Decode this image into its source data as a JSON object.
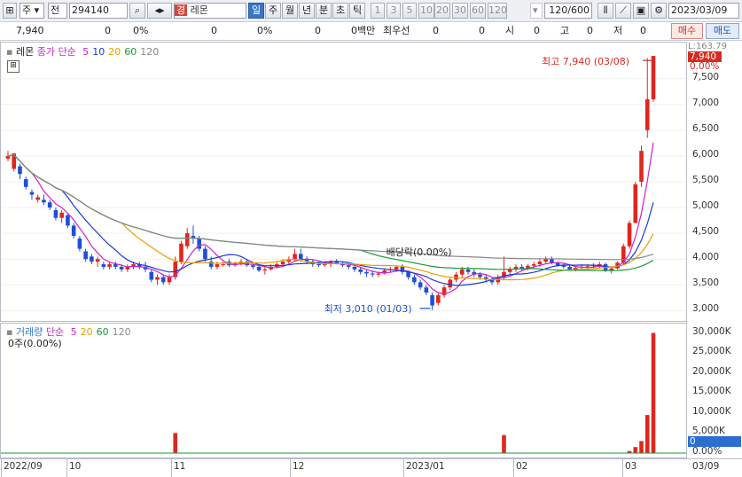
{
  "toolbar": {
    "market_label": "주",
    "prefix_label": "전",
    "code_value": "294140",
    "name_badge": "경",
    "name_value": "레몬",
    "periods": [
      "일",
      "주",
      "월",
      "년",
      "분",
      "초",
      "틱"
    ],
    "active_period": "일",
    "intervals": [
      "1",
      "3",
      "5",
      "10",
      "20",
      "30",
      "60",
      "120"
    ],
    "count_value": "120",
    "count_total": "/600",
    "date_value": "2023/03/09"
  },
  "quote": {
    "price": "7,940",
    "change": "0",
    "change_pct": "0%",
    "volume": "0",
    "vol_pct": "0%",
    "amount": "0",
    "amount_unit": "0백만",
    "best_label": "최우선",
    "best_value": "0",
    "open_value": "0",
    "open_label": "시",
    "open_v": "0",
    "high_label": "고",
    "high_v": "0",
    "low_label": "저",
    "low_v": "0",
    "buy_label": "매수",
    "sell_label": "매도"
  },
  "price_pane": {
    "stock_name": "레몬",
    "legend_title": "종가 단순",
    "ma": [
      "5",
      "10",
      "20",
      "60",
      "120"
    ],
    "ma_colors": [
      "#d020d0",
      "#1a3ad8",
      "#e8a000",
      "#1a9a3a",
      "#888888"
    ],
    "axis_ticks": [
      "7,500",
      "7,000",
      "6,500",
      "6,000",
      "5,500",
      "5,000",
      "4,500",
      "4,000",
      "3,500",
      "3,000"
    ],
    "top_label": "L:163.79",
    "price_tag": "7,940",
    "pct_tag": "0.00%",
    "high_note": "최고 7,940 (03/08)",
    "low_note": "최저 3,010 (01/03)",
    "div_note": "배당락(0.00%)"
  },
  "volume_pane": {
    "legend_title": "거래량",
    "legend_ma": "단순",
    "ma": [
      "5",
      "20",
      "60",
      "120"
    ],
    "readout": "0주(0.00%)",
    "axis_ticks": [
      "30,000K",
      "25,000K",
      "20,000K",
      "15,000K",
      "10,000K",
      "5,000K",
      "0.00%"
    ],
    "vol_tag": "0"
  },
  "date_axis": {
    "labels": [
      "2022/09",
      "10",
      "11",
      "12",
      "2023/01",
      "02",
      "03"
    ],
    "right_label": "03/09"
  },
  "chart_data": {
    "type": "candlestick",
    "y_range": [
      2800,
      8200
    ],
    "candles": [
      [
        5950,
        6100,
        5900,
        6000
      ],
      [
        5750,
        6050,
        5700,
        6050
      ],
      [
        5800,
        5850,
        5550,
        5650
      ],
      [
        5550,
        5600,
        5350,
        5400
      ],
      [
        5300,
        5350,
        5150,
        5250
      ],
      [
        5150,
        5250,
        5100,
        5200
      ],
      [
        5150,
        5250,
        5050,
        5100
      ],
      [
        5100,
        5150,
        4950,
        5000
      ],
      [
        4950,
        5000,
        4750,
        4800
      ],
      [
        4800,
        4950,
        4700,
        4900
      ],
      [
        4850,
        4900,
        4600,
        4650
      ],
      [
        4650,
        4700,
        4400,
        4450
      ],
      [
        4400,
        4450,
        4150,
        4200
      ],
      [
        4150,
        4200,
        3950,
        4000
      ],
      [
        4050,
        4100,
        3900,
        3950
      ],
      [
        3950,
        4050,
        3850,
        4000
      ],
      [
        3900,
        3950,
        3800,
        3850
      ],
      [
        3850,
        3950,
        3800,
        3900
      ],
      [
        3900,
        3950,
        3800,
        3850
      ],
      [
        3850,
        3900,
        3750,
        3800
      ],
      [
        3800,
        3900,
        3750,
        3850
      ],
      [
        3850,
        3950,
        3800,
        3900
      ],
      [
        3900,
        3950,
        3800,
        3850
      ],
      [
        3850,
        3950,
        3750,
        3800
      ],
      [
        3750,
        3800,
        3550,
        3600
      ],
      [
        3600,
        3700,
        3500,
        3650
      ],
      [
        3650,
        3700,
        3500,
        3550
      ],
      [
        3550,
        3700,
        3500,
        3650
      ],
      [
        3650,
        4050,
        3600,
        3950
      ],
      [
        3950,
        4350,
        3900,
        4300
      ],
      [
        4250,
        4600,
        4200,
        4500
      ],
      [
        4450,
        4650,
        4300,
        4400
      ],
      [
        4400,
        4450,
        4150,
        4200
      ],
      [
        4200,
        4250,
        3950,
        4000
      ],
      [
        3950,
        4050,
        3800,
        3850
      ],
      [
        3850,
        3950,
        3800,
        3900
      ],
      [
        3900,
        3950,
        3850,
        3900
      ],
      [
        3950,
        4000,
        3850,
        3880
      ],
      [
        3880,
        3950,
        3850,
        3920
      ],
      [
        3920,
        4000,
        3880,
        3950
      ],
      [
        3950,
        4000,
        3850,
        3880
      ],
      [
        3880,
        3920,
        3800,
        3850
      ],
      [
        3850,
        3900,
        3750,
        3780
      ],
      [
        3780,
        3850,
        3700,
        3800
      ],
      [
        3800,
        3900,
        3780,
        3850
      ],
      [
        3850,
        3950,
        3820,
        3900
      ],
      [
        3900,
        4000,
        3850,
        3950
      ],
      [
        3950,
        4050,
        3900,
        4000
      ],
      [
        4000,
        4200,
        3950,
        4100
      ],
      [
        4100,
        4200,
        3950,
        4000
      ],
      [
        4000,
        4050,
        3900,
        3950
      ],
      [
        3950,
        4000,
        3850,
        3900
      ],
      [
        3900,
        3950,
        3850,
        3880
      ],
      [
        3880,
        3950,
        3850,
        3900
      ],
      [
        3900,
        3980,
        3850,
        3950
      ],
      [
        3950,
        4000,
        3900,
        3920
      ],
      [
        3920,
        3960,
        3850,
        3880
      ],
      [
        3880,
        3920,
        3800,
        3850
      ],
      [
        3850,
        3900,
        3750,
        3800
      ],
      [
        3800,
        3850,
        3700,
        3750
      ],
      [
        3750,
        3800,
        3650,
        3720
      ],
      [
        3720,
        3780,
        3650,
        3700
      ],
      [
        3700,
        3760,
        3650,
        3720
      ],
      [
        3720,
        3800,
        3700,
        3780
      ],
      [
        3780,
        3850,
        3750,
        3800
      ],
      [
        3800,
        3880,
        3750,
        3850
      ],
      [
        3850,
        3900,
        3700,
        3750
      ],
      [
        3750,
        3780,
        3600,
        3650
      ],
      [
        3650,
        3700,
        3500,
        3550
      ],
      [
        3550,
        3600,
        3400,
        3450
      ],
      [
        3450,
        3500,
        3300,
        3350
      ],
      [
        3300,
        3350,
        3010,
        3100
      ],
      [
        3150,
        3350,
        3100,
        3300
      ],
      [
        3300,
        3500,
        3250,
        3450
      ],
      [
        3450,
        3650,
        3400,
        3600
      ],
      [
        3600,
        3750,
        3550,
        3700
      ],
      [
        3700,
        3850,
        3650,
        3800
      ],
      [
        3800,
        3850,
        3700,
        3750
      ],
      [
        3750,
        3800,
        3650,
        3700
      ],
      [
        3700,
        3750,
        3600,
        3650
      ],
      [
        3650,
        3700,
        3550,
        3600
      ],
      [
        3600,
        3650,
        3500,
        3550
      ],
      [
        3550,
        3700,
        3500,
        3650
      ],
      [
        3650,
        4050,
        3600,
        3750
      ],
      [
        3750,
        3850,
        3700,
        3800
      ],
      [
        3800,
        3900,
        3750,
        3850
      ],
      [
        3850,
        3900,
        3780,
        3820
      ],
      [
        3820,
        3900,
        3780,
        3870
      ],
      [
        3870,
        3950,
        3820,
        3900
      ],
      [
        3900,
        4000,
        3850,
        3950
      ],
      [
        3950,
        4050,
        3900,
        4000
      ],
      [
        4000,
        4050,
        3900,
        3920
      ],
      [
        3920,
        3960,
        3850,
        3880
      ],
      [
        3880,
        3920,
        3820,
        3850
      ],
      [
        3850,
        3900,
        3780,
        3800
      ],
      [
        3800,
        3860,
        3760,
        3830
      ],
      [
        3830,
        3880,
        3780,
        3850
      ],
      [
        3850,
        3900,
        3800,
        3860
      ],
      [
        3860,
        3920,
        3820,
        3880
      ],
      [
        3880,
        3950,
        3820,
        3900
      ],
      [
        3900,
        3930,
        3750,
        3780
      ],
      [
        3780,
        3850,
        3720,
        3820
      ],
      [
        3820,
        3950,
        3800,
        3930
      ],
      [
        3930,
        4300,
        3900,
        4250
      ],
      [
        4250,
        4750,
        4200,
        4700
      ],
      [
        4700,
        5500,
        5400,
        5450
      ],
      [
        5500,
        6200,
        5400,
        6100
      ],
      [
        6500,
        7900,
        6350,
        7100
      ],
      [
        7100,
        7940,
        7050,
        7940
      ]
    ],
    "volume_k": [
      0,
      0,
      0,
      0,
      0,
      0,
      0,
      0,
      0,
      0,
      0,
      0,
      0,
      0,
      0,
      0,
      0,
      0,
      0,
      0,
      0,
      0,
      0,
      0,
      0,
      0,
      0,
      0,
      5000,
      0,
      0,
      0,
      0,
      0,
      0,
      0,
      0,
      0,
      0,
      0,
      0,
      0,
      0,
      0,
      0,
      0,
      0,
      0,
      0,
      0,
      0,
      0,
      0,
      0,
      0,
      0,
      0,
      0,
      0,
      0,
      0,
      0,
      0,
      0,
      0,
      0,
      0,
      0,
      0,
      0,
      0,
      0,
      0,
      0,
      0,
      0,
      0,
      0,
      0,
      0,
      0,
      0,
      0,
      4500,
      0,
      0,
      0,
      0,
      0,
      0,
      0,
      0,
      0,
      0,
      0,
      0,
      0,
      0,
      0,
      0,
      0,
      0,
      0,
      0,
      500,
      1500,
      3000,
      9500,
      30000,
      0
    ],
    "volume_range": [
      0,
      31000
    ],
    "annotations": [
      {
        "text": "최고 7,940 (03/08)",
        "value": 7940
      },
      {
        "text": "최저 3,010 (01/03)",
        "value": 3010
      },
      {
        "text": "배당락(0.00%)",
        "value": 4000
      }
    ]
  }
}
